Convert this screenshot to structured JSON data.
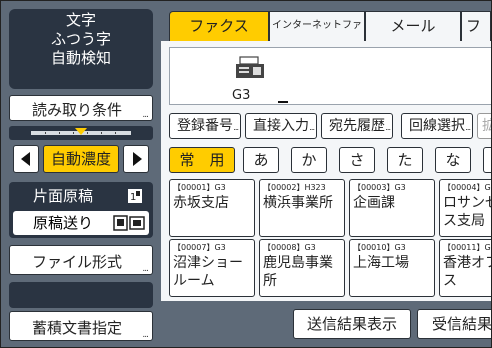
{
  "status": {
    "line1": "文字",
    "line2": "ふつう字",
    "line3": "自動検知"
  },
  "left": {
    "scan_settings": "読み取り条件",
    "density": "自動濃度",
    "original_type": "片面原稿",
    "original_feed": "原稿送り",
    "file_type": "ファイル形式",
    "store_file": "蓄積文書指定"
  },
  "tabs": [
    "ファクス",
    "インターネットファクス",
    "メール",
    "フ"
  ],
  "destination": {
    "line_label": "G3"
  },
  "search_buttons": [
    "登録番号",
    "直接入力",
    "宛先履歴",
    "回線選択",
    "拡"
  ],
  "kana_tabs": [
    "常　用",
    "あ",
    "か",
    "さ",
    "た",
    "な",
    "は"
  ],
  "addresses": [
    {
      "id": "【00001】G3",
      "name": "赤坂支店"
    },
    {
      "id": "【00002】H323",
      "name": "横浜事業所"
    },
    {
      "id": "【00003】G3",
      "name": "企画課"
    },
    {
      "id": "【00004】G3",
      "name": "ロサンゼルス支局"
    },
    {
      "id": "【00007】G3",
      "name": "沼津ショールーム"
    },
    {
      "id": "【00008】G3",
      "name": "鹿児島事業所"
    },
    {
      "id": "【00010】G3",
      "name": "上海工場"
    },
    {
      "id": "【00011】G3",
      "name": "香港オフィス"
    }
  ],
  "bottom": {
    "tx_result": "送信結果表示",
    "rx_result": "受信結果"
  },
  "colors": {
    "accent": "#ffcc00",
    "panel": "#5e6a78",
    "dark": "#2a3442"
  }
}
